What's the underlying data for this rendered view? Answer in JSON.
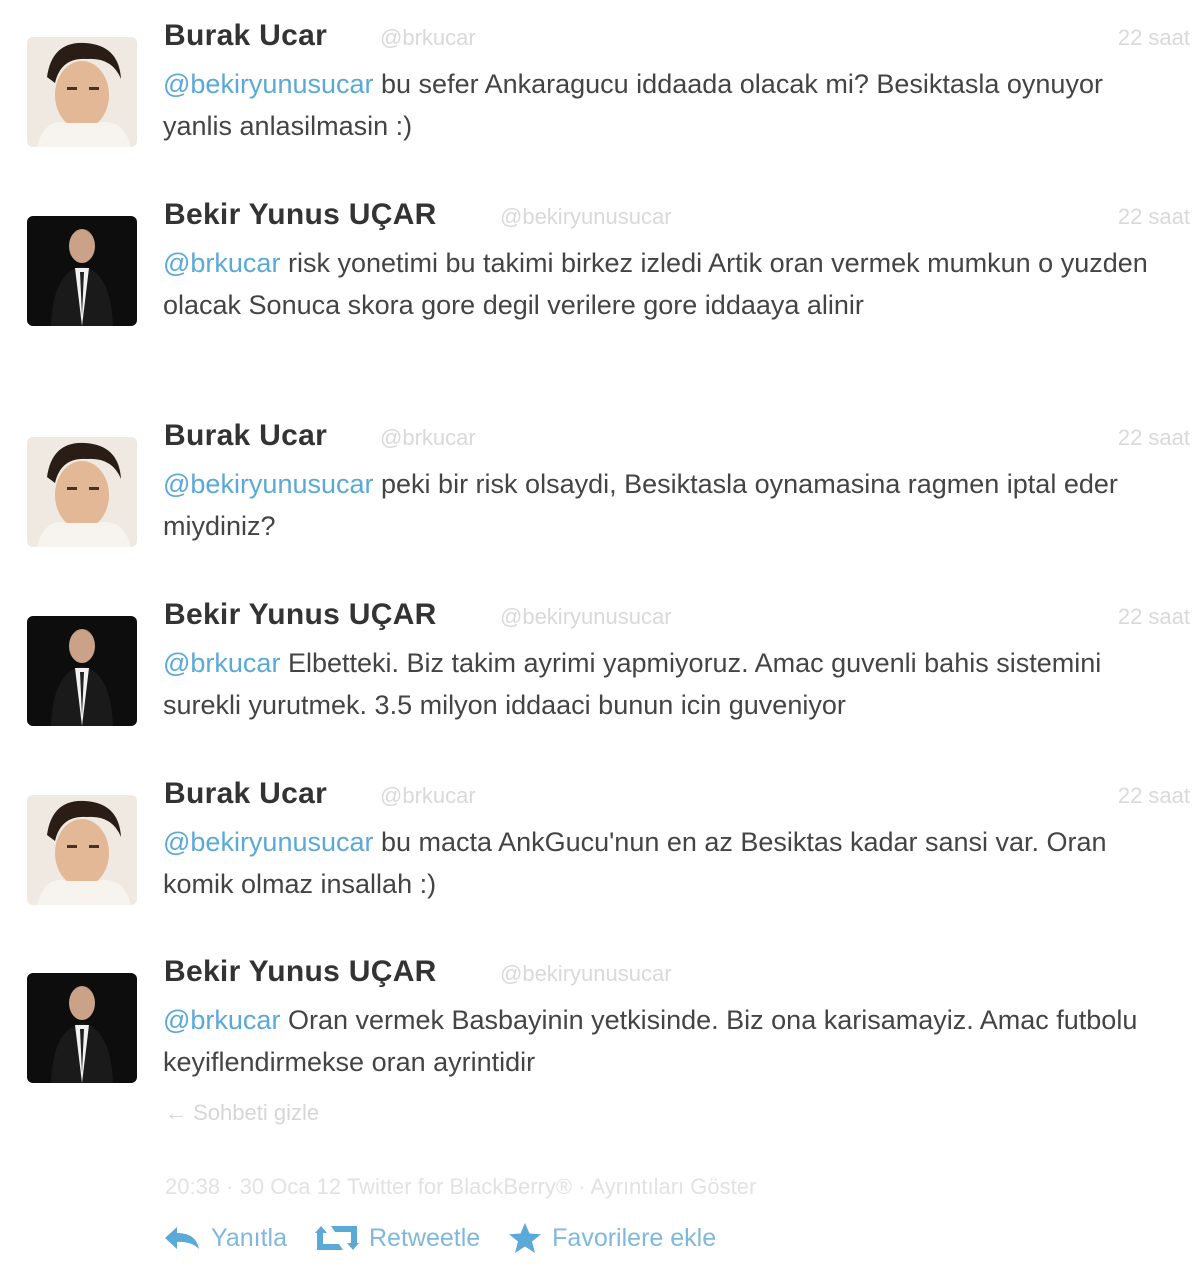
{
  "tweets": [
    {
      "name": "Burak Ucar",
      "handle": "@brkucar",
      "time": "22 saat",
      "mention": "@bekiryunusucar",
      "text": " bu sefer Ankaragucu iddaada olacak mi? Besiktasla oynuyor yanlis anlasilmasin :)",
      "avatar": "burak"
    },
    {
      "name": "Bekir Yunus UÇAR",
      "handle": "@bekiryunusucar",
      "time": "22 saat",
      "mention": "@brkucar",
      "text": " risk yonetimi bu takimi birkez izledi Artik oran vermek mumkun o yuzden olacak Sonuca skora gore degil verilere gore iddaaya alinir",
      "avatar": "bekir"
    },
    {
      "name": "Burak Ucar",
      "handle": "@brkucar",
      "time": "22 saat",
      "mention": "@bekiryunusucar",
      "text": " peki bir risk olsaydi, Besiktasla oynamasina ragmen iptal eder miydiniz?",
      "avatar": "burak"
    },
    {
      "name": "Bekir Yunus UÇAR",
      "handle": "@bekiryunusucar",
      "time": "22 saat",
      "mention": "@brkucar",
      "text": " Elbetteki. Biz takim ayrimi yapmiyoruz. Amac guvenli bahis sistemini surekli yurutmek. 3.5 milyon iddaaci bunun icin guveniyor",
      "avatar": "bekir"
    },
    {
      "name": "Burak Ucar",
      "handle": "@brkucar",
      "time": "22 saat",
      "mention": "@bekiryunusucar",
      "text": " bu macta AnkGucu'nun en az Besiktas kadar sansi var. Oran komik olmaz insallah :)",
      "avatar": "burak"
    },
    {
      "name": "Bekir Yunus UÇAR",
      "handle": "@bekiryunusucar",
      "time": "",
      "mention": "@brkucar",
      "text": " Oran vermek Basbayinin yetkisinde. Biz ona karisamayiz. Amac futbolu keyiflendirmekse oran ayrintidir",
      "avatar": "bekir"
    }
  ],
  "expand_label": "Sohbeti gizle",
  "footer_meta": "20:38 · 30 Oca 12 Twitter for BlackBerry® · Ayrıntıları Göster",
  "actions": {
    "reply": "Yanıtla",
    "retweet": "Retweetle",
    "favorite": "Favorilere ekle"
  },
  "colors": {
    "mention": "#5aa9d6",
    "action": "#7fb8dc"
  }
}
